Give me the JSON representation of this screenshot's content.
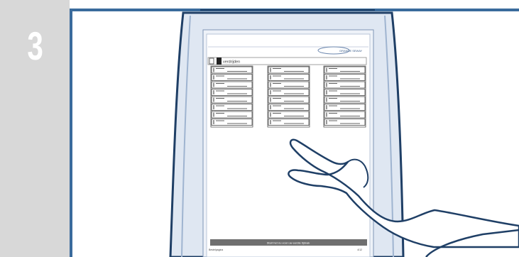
{
  "step": {
    "number": "3"
  },
  "screen": {
    "logo_text": "GRANDE SEWAY",
    "tab_label": "verdrijden",
    "bottom_bar_label": "Start het nu voor uw eerste tijdvak",
    "footer_left": "Bestelpagina",
    "footer_right": "4/12",
    "grid": {
      "columns": 3,
      "rows": 8
    }
  },
  "colors": {
    "step_panel": "#d8d8d8",
    "frame_border": "#3a6b9c",
    "device_body": "#dfe7f2",
    "outline": "#1f3f66"
  },
  "icons": {
    "pointer": "hand-pointing-icon",
    "back": "back-arrow-icon"
  }
}
